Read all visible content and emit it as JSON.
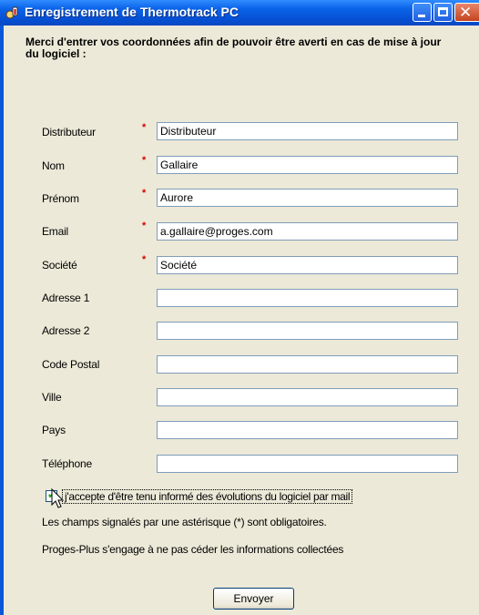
{
  "window": {
    "title": "Enregistrement de Thermotrack PC",
    "icon": "thermotrack-app-icon"
  },
  "intro": "Merci d'entrer vos coordonnées afin de pouvoir être averti en cas de mise à jour du logiciel :",
  "required_marker": "*",
  "fields": [
    {
      "label": "Distributeur",
      "value": "Distributeur",
      "required": true
    },
    {
      "label": "Nom",
      "value": "Gallaire",
      "required": true
    },
    {
      "label": "Prénom",
      "value": "Aurore",
      "required": true
    },
    {
      "label": "Email",
      "value": "a.gallaire@proges.com",
      "required": true
    },
    {
      "label": "Société",
      "value": "Société",
      "required": true
    },
    {
      "label": "Adresse 1",
      "value": "",
      "required": false
    },
    {
      "label": "Adresse 2",
      "value": "",
      "required": false
    },
    {
      "label": "Code Postal",
      "value": "",
      "required": false
    },
    {
      "label": "Ville",
      "value": "",
      "required": false
    },
    {
      "label": "Pays",
      "value": "",
      "required": false
    },
    {
      "label": "Téléphone",
      "value": "",
      "required": false
    }
  ],
  "consent": {
    "label": "j'accepte d'être tenu informé des évolutions du logiciel par mail",
    "checked": true
  },
  "notes": {
    "required_info": "Les champs signalés par une astérisque (*) sont obligatoires.",
    "privacy": "Proges-Plus s'engage à ne pas céder les informations collectées"
  },
  "buttons": {
    "send": "Envoyer"
  }
}
